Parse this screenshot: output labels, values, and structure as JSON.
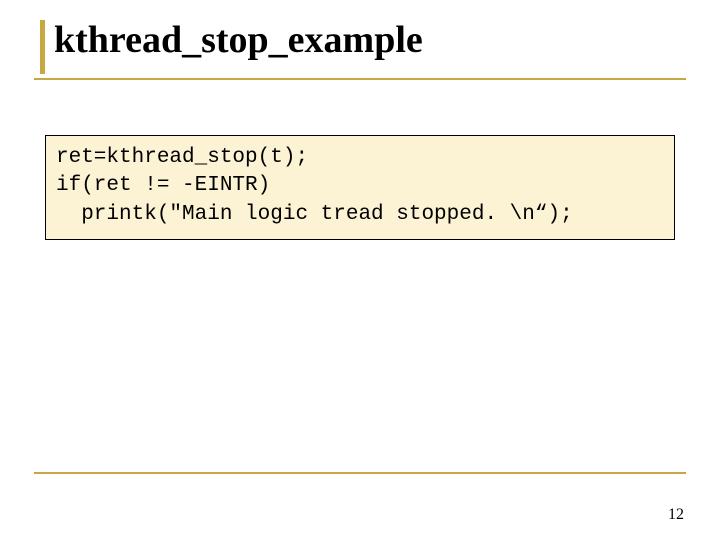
{
  "slide": {
    "title": "kthread_stop_example",
    "code_lines": [
      "ret=kthread_stop(t);",
      "if(ret != -EINTR)",
      "  printk(\"Main logic tread stopped. \\n“);"
    ],
    "page_number": "12"
  }
}
